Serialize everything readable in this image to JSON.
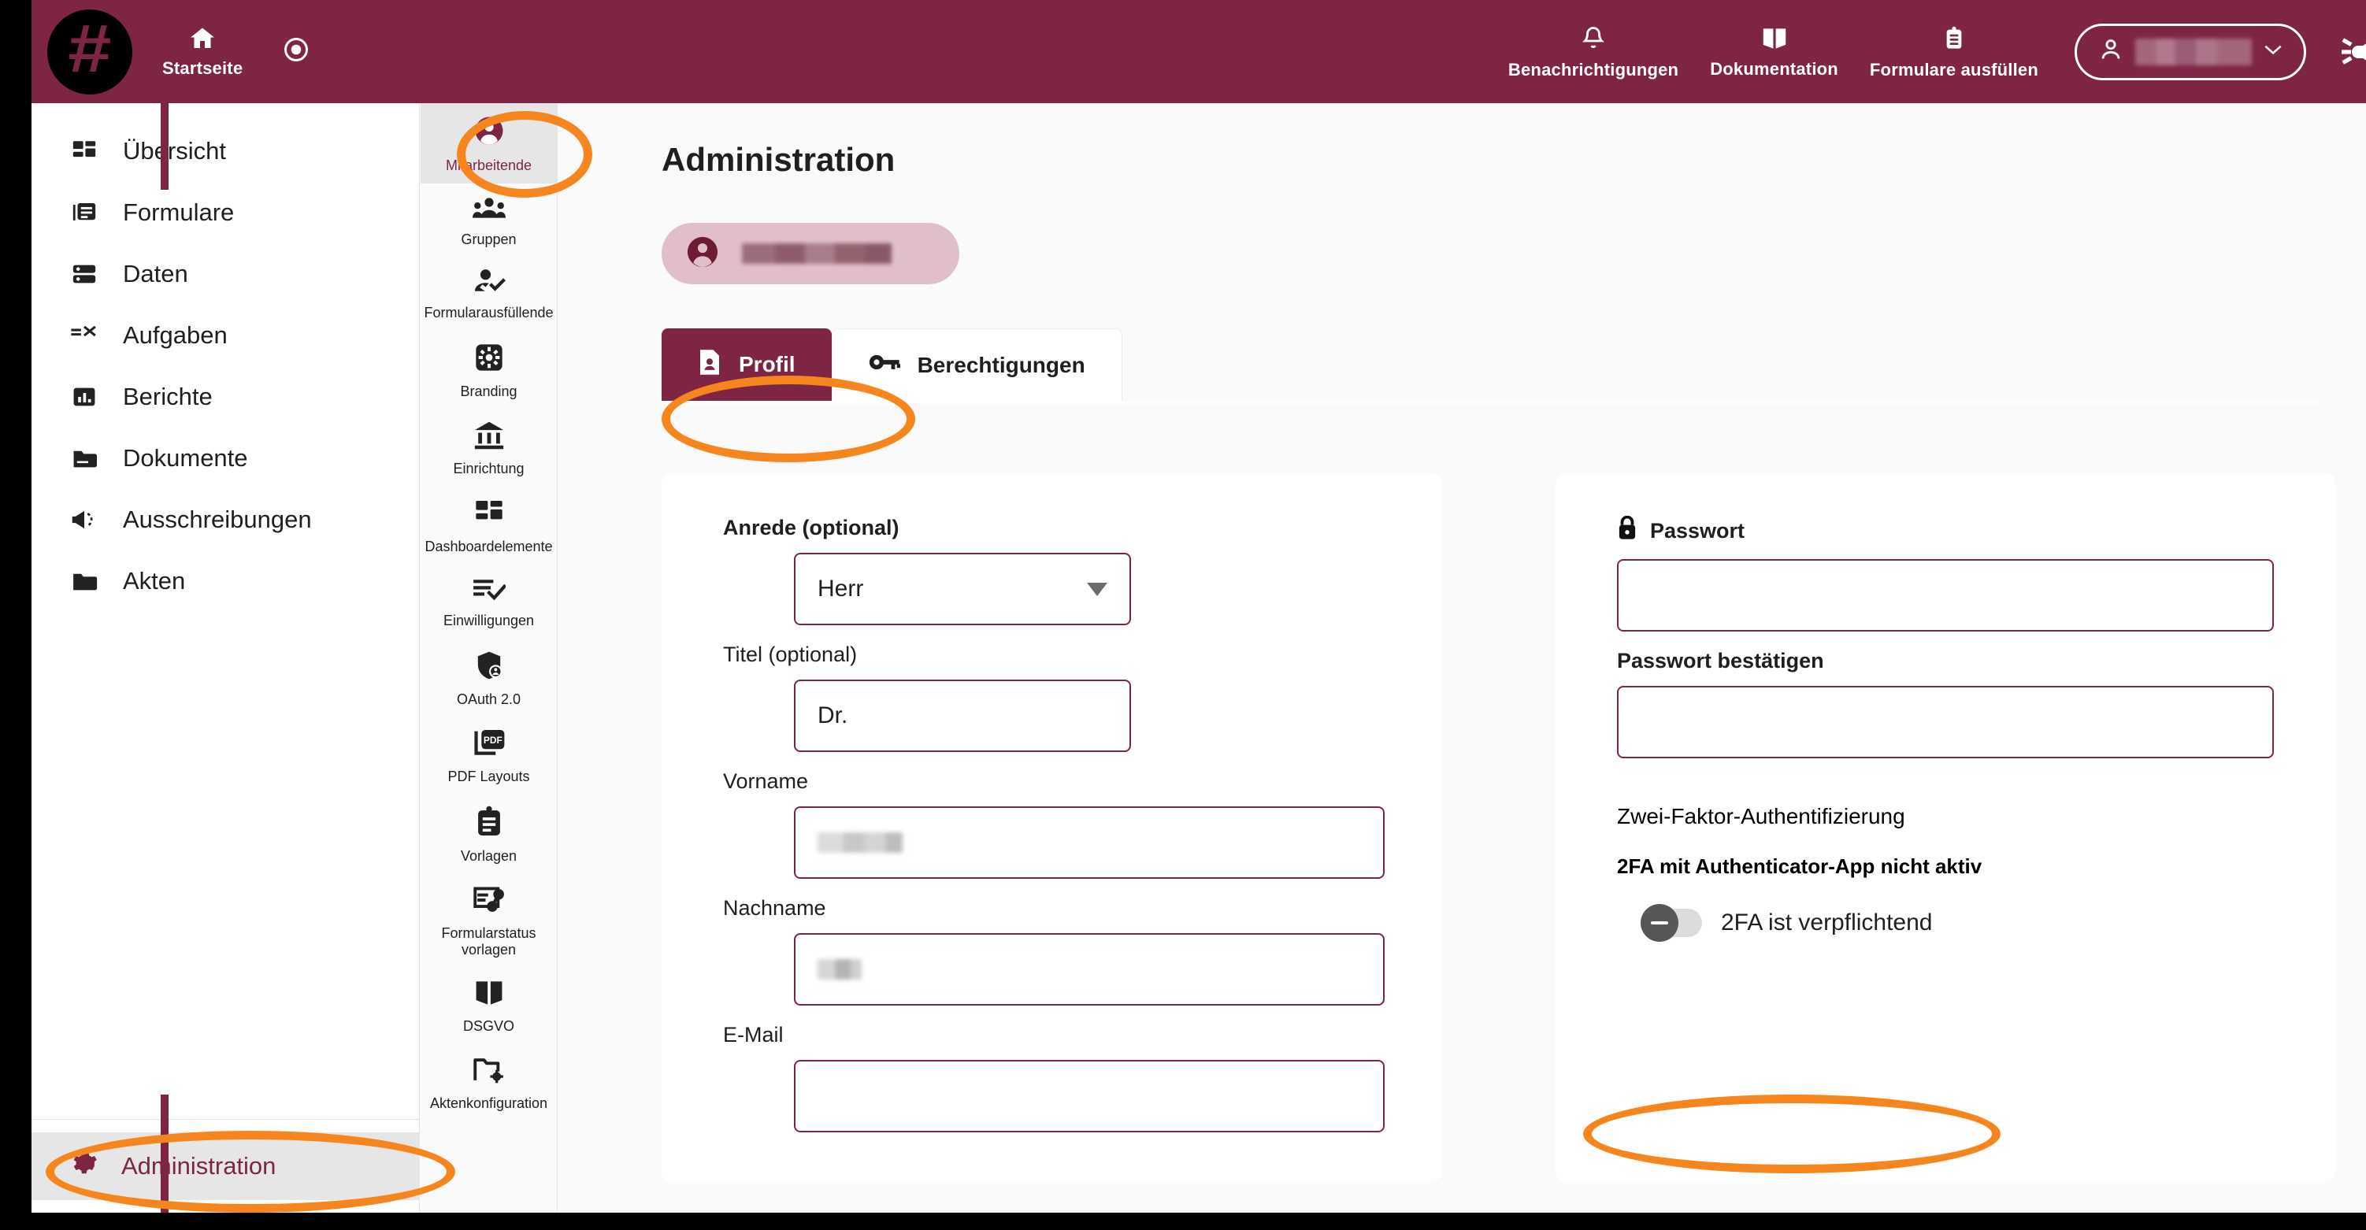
{
  "colors": {
    "brand": "#7e2545",
    "annotation": "#f7851e",
    "page_bg": "#fafafa",
    "card_bg": "#ffffff",
    "active_nav_bg": "#e6e6e6",
    "chip_bg": "#e0bfcb"
  },
  "header": {
    "logo_glyph": "#",
    "items": [
      {
        "label": "Startseite",
        "icon": "home-icon"
      }
    ],
    "record_button_icon": "record-circle-icon",
    "right_items": [
      {
        "label": "Benachrichtigungen",
        "icon": "bell-icon"
      },
      {
        "label": "Dokumentation",
        "icon": "book-icon"
      },
      {
        "label": "Formulare ausfüllen",
        "icon": "clipboard-list-icon"
      }
    ],
    "user_menu": {
      "icon": "user-icon",
      "name": "",
      "chevron": "chevron-down-icon"
    },
    "announcement_icon": "megaphone-icon"
  },
  "sidebar": {
    "items": [
      {
        "label": "Übersicht",
        "icon": "dashboard-icon"
      },
      {
        "label": "Formulare",
        "icon": "forms-icon"
      },
      {
        "label": "Daten",
        "icon": "database-icon"
      },
      {
        "label": "Aufgaben",
        "icon": "tasks-icon"
      },
      {
        "label": "Berichte",
        "icon": "chart-icon"
      },
      {
        "label": "Dokumente",
        "icon": "folder-document-icon"
      },
      {
        "label": "Ausschreibungen",
        "icon": "megaphone-icon"
      },
      {
        "label": "Akten",
        "icon": "folder-icon"
      }
    ],
    "bottom": {
      "label": "Administration",
      "icon": "gear-icon",
      "active": true
    }
  },
  "subnav": {
    "items": [
      {
        "label": "Mitarbeitende",
        "icon": "user-circle-icon",
        "active": true
      },
      {
        "label": "Gruppen",
        "icon": "people-group-icon",
        "active": false
      },
      {
        "label": "Formularausfüllende",
        "icon": "user-check-icon",
        "active": false
      },
      {
        "label": "Branding",
        "icon": "gear-square-icon",
        "active": false
      },
      {
        "label": "Einrichtung",
        "icon": "bank-icon",
        "active": false
      },
      {
        "label": "Dashboardelemente",
        "icon": "dashboard-icon",
        "active": false
      },
      {
        "label": "Einwilligungen",
        "icon": "list-check-icon",
        "active": false
      },
      {
        "label": "OAuth 2.0",
        "icon": "shield-user-icon",
        "active": false
      },
      {
        "label": "PDF Layouts",
        "icon": "pdf-icon",
        "active": false
      },
      {
        "label": "Vorlagen",
        "icon": "clipboard-icon",
        "active": false
      },
      {
        "label": "Formularstatus vorlagen",
        "icon": "form-status-icon",
        "active": false
      },
      {
        "label": "DSGVO",
        "icon": "book-icon",
        "active": false
      },
      {
        "label": "Aktenkonfiguration",
        "icon": "folder-gear-icon",
        "active": false
      }
    ]
  },
  "main": {
    "page_title": "Administration",
    "user_chip": {
      "icon": "user-circle-icon",
      "name": ""
    },
    "tabs": [
      {
        "label": "Profil",
        "icon": "profile-card-icon",
        "active": true
      },
      {
        "label": "Berechtigungen",
        "icon": "key-icon",
        "active": false
      }
    ],
    "profile_card": {
      "fields": [
        {
          "label": "Anrede (optional)",
          "type": "select",
          "value": "Herr",
          "placeholder": ""
        },
        {
          "label": "Titel (optional)",
          "type": "text",
          "value": "Dr.",
          "placeholder": ""
        },
        {
          "label": "Vorname",
          "type": "text",
          "value": "",
          "placeholder": "",
          "redacted": true
        },
        {
          "label": "Nachname",
          "type": "text",
          "value": "",
          "placeholder": "",
          "redacted": true
        },
        {
          "label": "E-Mail",
          "type": "text",
          "value": "",
          "placeholder": ""
        }
      ]
    },
    "security_card": {
      "password_label": "Passwort",
      "password_icon": "lock-icon",
      "password_value": "",
      "password_confirm_label": "Passwort bestätigen",
      "password_confirm_value": "",
      "twofa_title": "Zwei-Faktor-Authentifizierung",
      "twofa_status": "2FA mit Authenticator-App nicht aktiv",
      "twofa_toggle_label": "2FA ist verpflichtend",
      "twofa_toggle_state": "off"
    }
  },
  "annotations": [
    {
      "name": "mitarbeitende-highlight",
      "shape": "ellipse",
      "color": "#f7851e"
    },
    {
      "name": "profil-tab-highlight",
      "shape": "ellipse",
      "color": "#f7851e"
    },
    {
      "name": "twofa-toggle-highlight",
      "shape": "ellipse",
      "color": "#f7851e"
    },
    {
      "name": "administration-highlight",
      "shape": "ellipse",
      "color": "#f7851e"
    }
  ]
}
